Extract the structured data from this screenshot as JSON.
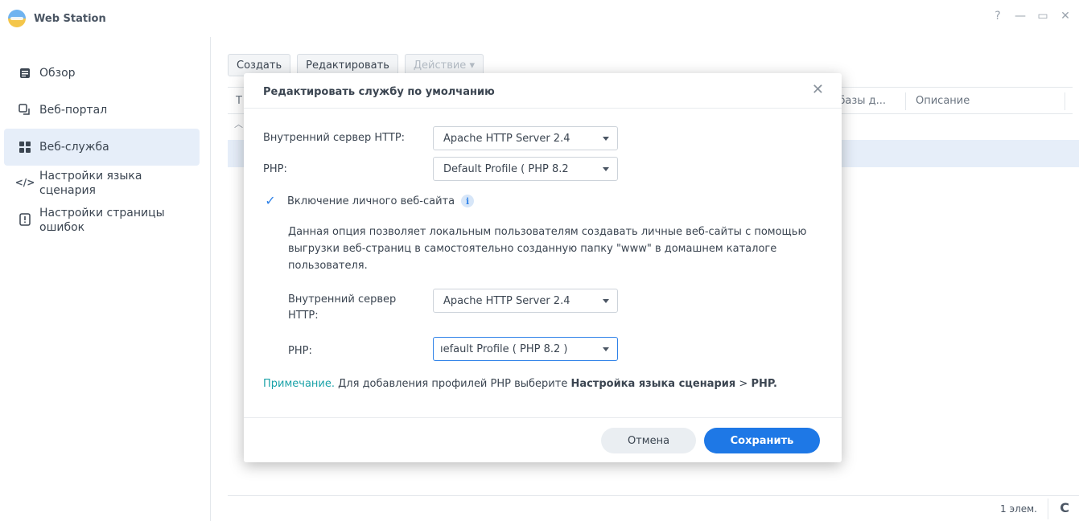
{
  "window": {
    "title": "Web Station",
    "controls": {
      "help": "?",
      "minimize": "—",
      "maximize": "▭",
      "close": "✕"
    }
  },
  "sidebar": {
    "items": [
      {
        "label": "Обзор",
        "icon": "overview-icon"
      },
      {
        "label": "Веб-портал",
        "icon": "web-portal-icon"
      },
      {
        "label": "Веб-служба",
        "icon": "web-service-icon",
        "active": true
      },
      {
        "label": "Настройки языка сценария",
        "icon": "script-language-icon"
      },
      {
        "label": "Настройки страницы ошибок",
        "icon": "error-page-icon"
      }
    ]
  },
  "toolbar": {
    "create": "Создать",
    "edit": "Редактировать",
    "action": "Действие ▾"
  },
  "grid": {
    "columns": [
      "Т",
      "/базы д...",
      "Описание"
    ],
    "footer_count": "1 элем."
  },
  "modal": {
    "title": "Редактировать службу по умолчанию",
    "close": "✕",
    "http_label": "Внутренний сервер HTTP:",
    "http_value": "Apache HTTP Server 2.4",
    "php_label": "PHP:",
    "php_value": "Default Profile ( PHP 8.2",
    "personal_label": "Включение личного веб-сайта",
    "personal_checked": true,
    "description": "Данная опция позволяет локальным пользователям создавать личные веб-сайты с помощью выгрузки веб-страниц в самостоятельно созданную папку \"www\" в домашнем каталоге пользователя.",
    "personal_http_label": "Внутренний сервер HTTP:",
    "personal_http_value": "Apache HTTP Server 2.4",
    "personal_php_label": "PHP:",
    "personal_php_value": "ıefault Profile ( PHP 8.2 )",
    "note_label": "Примечание.",
    "note_text": " Для добавления профилей PHP выберите ",
    "note_bold": "Настройка языка сценария",
    "note_sep": " > ",
    "note_bold2": "PHP",
    "note_end": ".",
    "cancel": "Отмена",
    "save": "Сохранить"
  },
  "colors": {
    "accent": "#1e78e6",
    "note": "#1aa2a8",
    "selected_row": "#e6eef9"
  }
}
